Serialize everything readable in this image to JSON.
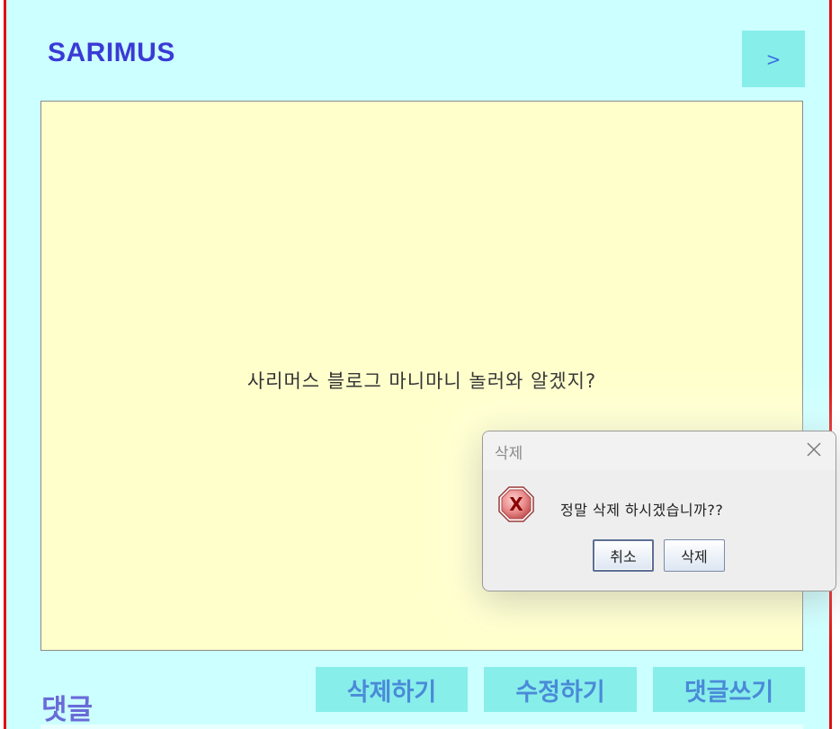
{
  "header": {
    "brand": "SARIMUS",
    "next_label": ">"
  },
  "post": {
    "body": "사리머스 블로그 마니마니 놀러와 알겠지?"
  },
  "comments": {
    "label": "댓글"
  },
  "actions": {
    "delete_label": "삭제하기",
    "edit_label": "수정하기",
    "comment_label": "댓글쓰기"
  },
  "dialog": {
    "title": "삭제",
    "message": "정말 삭제 하시겠습니까??",
    "cancel_label": "취소",
    "confirm_label": "삭제",
    "icon": "error-icon"
  },
  "colors": {
    "frame_background": "#ccffff",
    "frame_border": "#e01010",
    "content_background": "#ffffcc",
    "button_background": "#88eeea",
    "brand_color": "#3a3ad6"
  }
}
